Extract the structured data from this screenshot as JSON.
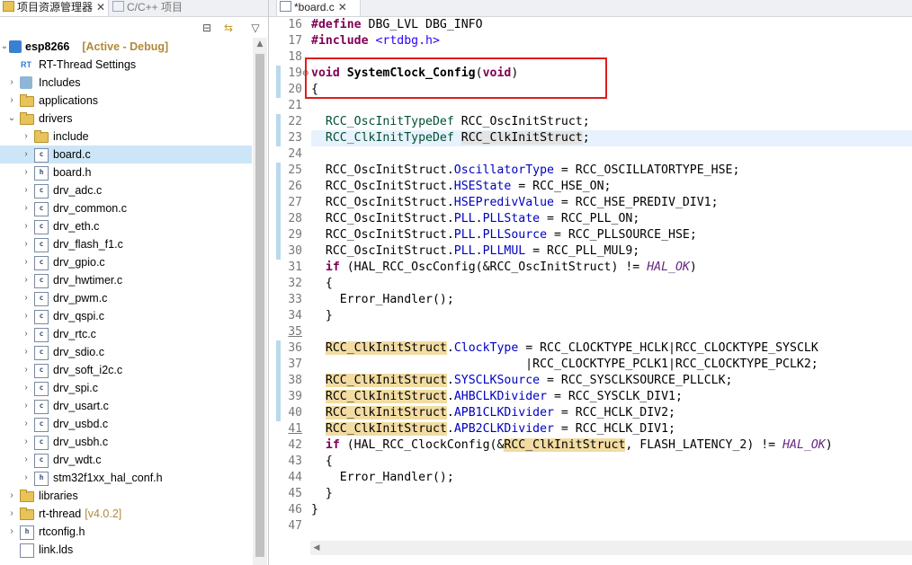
{
  "explorer": {
    "tab_active_label": "项目资源管理器",
    "tab_inactive_label": "C/C++ 项目",
    "tab_close": "✕",
    "toolbar": {
      "collapse_icon": "collapse-all-icon",
      "link_icon": "link-with-editor-icon",
      "menu_icon": "view-menu-icon"
    },
    "project": {
      "name": "esp8266",
      "decoration": "[Active - Debug]"
    },
    "items": [
      {
        "label": "RT-Thread Settings",
        "icon": "rt-thread-settings-icon"
      },
      {
        "label": "Includes",
        "icon": "includes-icon"
      },
      {
        "label": "applications",
        "icon": "folder-icon"
      },
      {
        "label": "drivers",
        "icon": "folder-icon"
      },
      {
        "label": "include",
        "icon": "folder-icon"
      },
      {
        "label": "board.c",
        "icon": "c-file-icon"
      },
      {
        "label": "board.h",
        "icon": "h-file-icon"
      },
      {
        "label": "drv_adc.c",
        "icon": "c-file-icon"
      },
      {
        "label": "drv_common.c",
        "icon": "c-file-icon"
      },
      {
        "label": "drv_eth.c",
        "icon": "c-file-icon"
      },
      {
        "label": "drv_flash_f1.c",
        "icon": "c-file-icon"
      },
      {
        "label": "drv_gpio.c",
        "icon": "c-file-icon"
      },
      {
        "label": "drv_hwtimer.c",
        "icon": "c-file-icon"
      },
      {
        "label": "drv_pwm.c",
        "icon": "c-file-icon"
      },
      {
        "label": "drv_qspi.c",
        "icon": "c-file-icon"
      },
      {
        "label": "drv_rtc.c",
        "icon": "c-file-icon"
      },
      {
        "label": "drv_sdio.c",
        "icon": "c-file-icon"
      },
      {
        "label": "drv_soft_i2c.c",
        "icon": "c-file-icon"
      },
      {
        "label": "drv_spi.c",
        "icon": "c-file-icon"
      },
      {
        "label": "drv_usart.c",
        "icon": "c-file-icon"
      },
      {
        "label": "drv_usbd.c",
        "icon": "c-file-icon"
      },
      {
        "label": "drv_usbh.c",
        "icon": "c-file-icon"
      },
      {
        "label": "drv_wdt.c",
        "icon": "c-file-icon"
      },
      {
        "label": "stm32f1xx_hal_conf.h",
        "icon": "h-file-icon"
      },
      {
        "label": "libraries",
        "icon": "folder-icon"
      },
      {
        "label": "rt-thread",
        "icon": "folder-icon",
        "decoration": "[v4.0.2]"
      },
      {
        "label": "rtconfig.h",
        "icon": "h-file-icon"
      },
      {
        "label": "link.lds",
        "icon": "file-icon"
      }
    ],
    "selected": "board.c"
  },
  "editor": {
    "tab_label": "*board.c",
    "tab_close": "✕",
    "line_numbers": [
      "16",
      "17",
      "18",
      "19",
      "20",
      "21",
      "22",
      "23",
      "24",
      "25",
      "26",
      "27",
      "28",
      "29",
      "30",
      "31",
      "32",
      "33",
      "34",
      "35",
      "36",
      "37",
      "38",
      "39",
      "40",
      "41",
      "42",
      "43",
      "44",
      "45",
      "46",
      "47"
    ],
    "lines": {
      "l16_a": "#define",
      "l16_b": " DBG_LVL DBG_INFO",
      "l17_a": "#include",
      "l17_b": " <rtdbg.h>",
      "l19_a": "void",
      "l19_b": " SystemClock_Config",
      "l19_c": "(",
      "l19_d": "void",
      "l19_e": ")",
      "l20": "{",
      "l22_a": "  RCC_OscInitTypeDef",
      "l22_b": " RCC_OscInitStruct;",
      "l23_a": "  RCC_ClkInitTypeDef",
      "l23_b": " ",
      "l23_c": "RCC_ClkInitStruct",
      "l23_d": ";",
      "l25_a": "  RCC_OscInitStruct.",
      "l25_b": "OscillatorType",
      "l25_c": " = RCC_OSCILLATORTYPE_HSE;",
      "l26_a": "  RCC_OscInitStruct.",
      "l26_b": "HSEState",
      "l26_c": " = RCC_HSE_ON;",
      "l27_a": "  RCC_OscInitStruct.",
      "l27_b": "HSEPredivValue",
      "l27_c": " = RCC_HSE_PREDIV_DIV1;",
      "l28_a": "  RCC_OscInitStruct.",
      "l28_b": "PLL",
      "l28_c": ".",
      "l28_d": "PLLState",
      "l28_e": " = RCC_PLL_ON;",
      "l29_a": "  RCC_OscInitStruct.",
      "l29_b": "PLL",
      "l29_c": ".",
      "l29_d": "PLLSource",
      "l29_e": " = RCC_PLLSOURCE_HSE;",
      "l30_a": "  RCC_OscInitStruct.",
      "l30_b": "PLL",
      "l30_c": ".",
      "l30_d": "PLLMUL",
      "l30_e": " = RCC_PLL_MUL9;",
      "l31_a": "  ",
      "l31_b": "if",
      "l31_c": " (HAL_RCC_OscConfig(&RCC_OscInitStruct) != ",
      "l31_d": "HAL_OK",
      "l31_e": ")",
      "l32": "  {",
      "l33": "    Error_Handler();",
      "l34": "  }",
      "l36_a": "  ",
      "l36_b": "RCC_ClkInitStruct",
      "l36_c": ".",
      "l36_d": "ClockType",
      "l36_e": " = RCC_CLOCKTYPE_HCLK|RCC_CLOCKTYPE_SYSCLK",
      "l37": "                              |RCC_CLOCKTYPE_PCLK1|RCC_CLOCKTYPE_PCLK2;",
      "l38_a": "  ",
      "l38_b": "RCC_ClkInitStruct",
      "l38_c": ".",
      "l38_d": "SYSCLKSource",
      "l38_e": " = RCC_SYSCLKSOURCE_PLLCLK;",
      "l39_a": "  ",
      "l39_b": "RCC_ClkInitStruct",
      "l39_c": ".",
      "l39_d": "AHBCLKDivider",
      "l39_e": " = RCC_SYSCLK_DIV1;",
      "l40_a": "  ",
      "l40_b": "RCC_ClkInitStruct",
      "l40_c": ".",
      "l40_d": "APB1CLKDivider",
      "l40_e": " = RCC_HCLK_DIV2;",
      "l41_a": "  ",
      "l41_b": "RCC_ClkInitStruct",
      "l41_c": ".",
      "l41_d": "APB2CLKDivider",
      "l41_e": " = RCC_HCLK_DIV1;",
      "l42_a": "  ",
      "l42_b": "if",
      "l42_c": " (HAL_RCC_ClockConfig(&",
      "l42_d": "RCC_ClkInitStruct",
      "l42_e": ", FLASH_LATENCY_2) != ",
      "l42_f": "HAL_OK",
      "l42_g": ")",
      "l43": "  {",
      "l44": "    Error_Handler();",
      "l45": "  }",
      "l46": "}"
    }
  },
  "colors": {
    "keyword": "#7f0055",
    "field": "#0000c0",
    "macro": "#642880",
    "occurrence_highlight": "#f2dca3",
    "annotation_box": "#e21b1b",
    "selection": "#cde6f7"
  }
}
